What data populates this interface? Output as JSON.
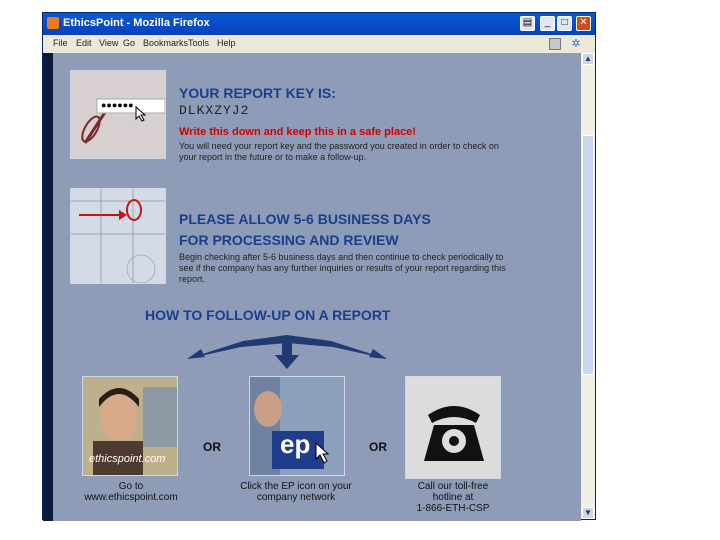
{
  "window": {
    "title": "EthicsPoint - Mozilla Firefox"
  },
  "menu": {
    "items": [
      "File",
      "Edit",
      "View",
      "Go",
      "Bookmarks",
      "Tools",
      "Help"
    ]
  },
  "report_key": {
    "heading": "YOUR REPORT KEY IS:",
    "key": "DLKXZYJ2",
    "password_mask": "●●●●●●",
    "warning": "Write this down and keep this in a safe place!",
    "body": "You will need your report key and the password you created in order to check on your report in the future or to make a follow-up."
  },
  "processing": {
    "heading_line1": "PLEASE ALLOW 5-6 BUSINESS DAYS",
    "heading_line2": "FOR PROCESSING AND REVIEW",
    "body": "Begin checking after 5-6 business days and then continue to check periodically to see if the company has any further inquiries or results of your report regarding this report."
  },
  "follow_up": {
    "heading": "HOW TO FOLLOW-UP ON A REPORT",
    "or_label": "OR",
    "options": [
      {
        "caption_line1": "Go to",
        "caption_line2": "www.ethicspoint.com",
        "caption_line3": "",
        "caption_line4": "",
        "photo_text": "ethicspoint.com"
      },
      {
        "caption_line1": "Click the EP icon on your",
        "caption_line2": "company network",
        "caption_line3": "",
        "caption_line4": "",
        "photo_text": "ep"
      },
      {
        "caption_line1": "Call our toll-free",
        "caption_line2": "hotline at",
        "caption_line3": "1-866-ETH-CSP",
        "caption_line4": "",
        "photo_text": ""
      }
    ]
  },
  "colors": {
    "content_bg": "#8f9cb8",
    "heading": "#1a3f8a",
    "warning": "#d00000",
    "arrow": "#203a72"
  }
}
